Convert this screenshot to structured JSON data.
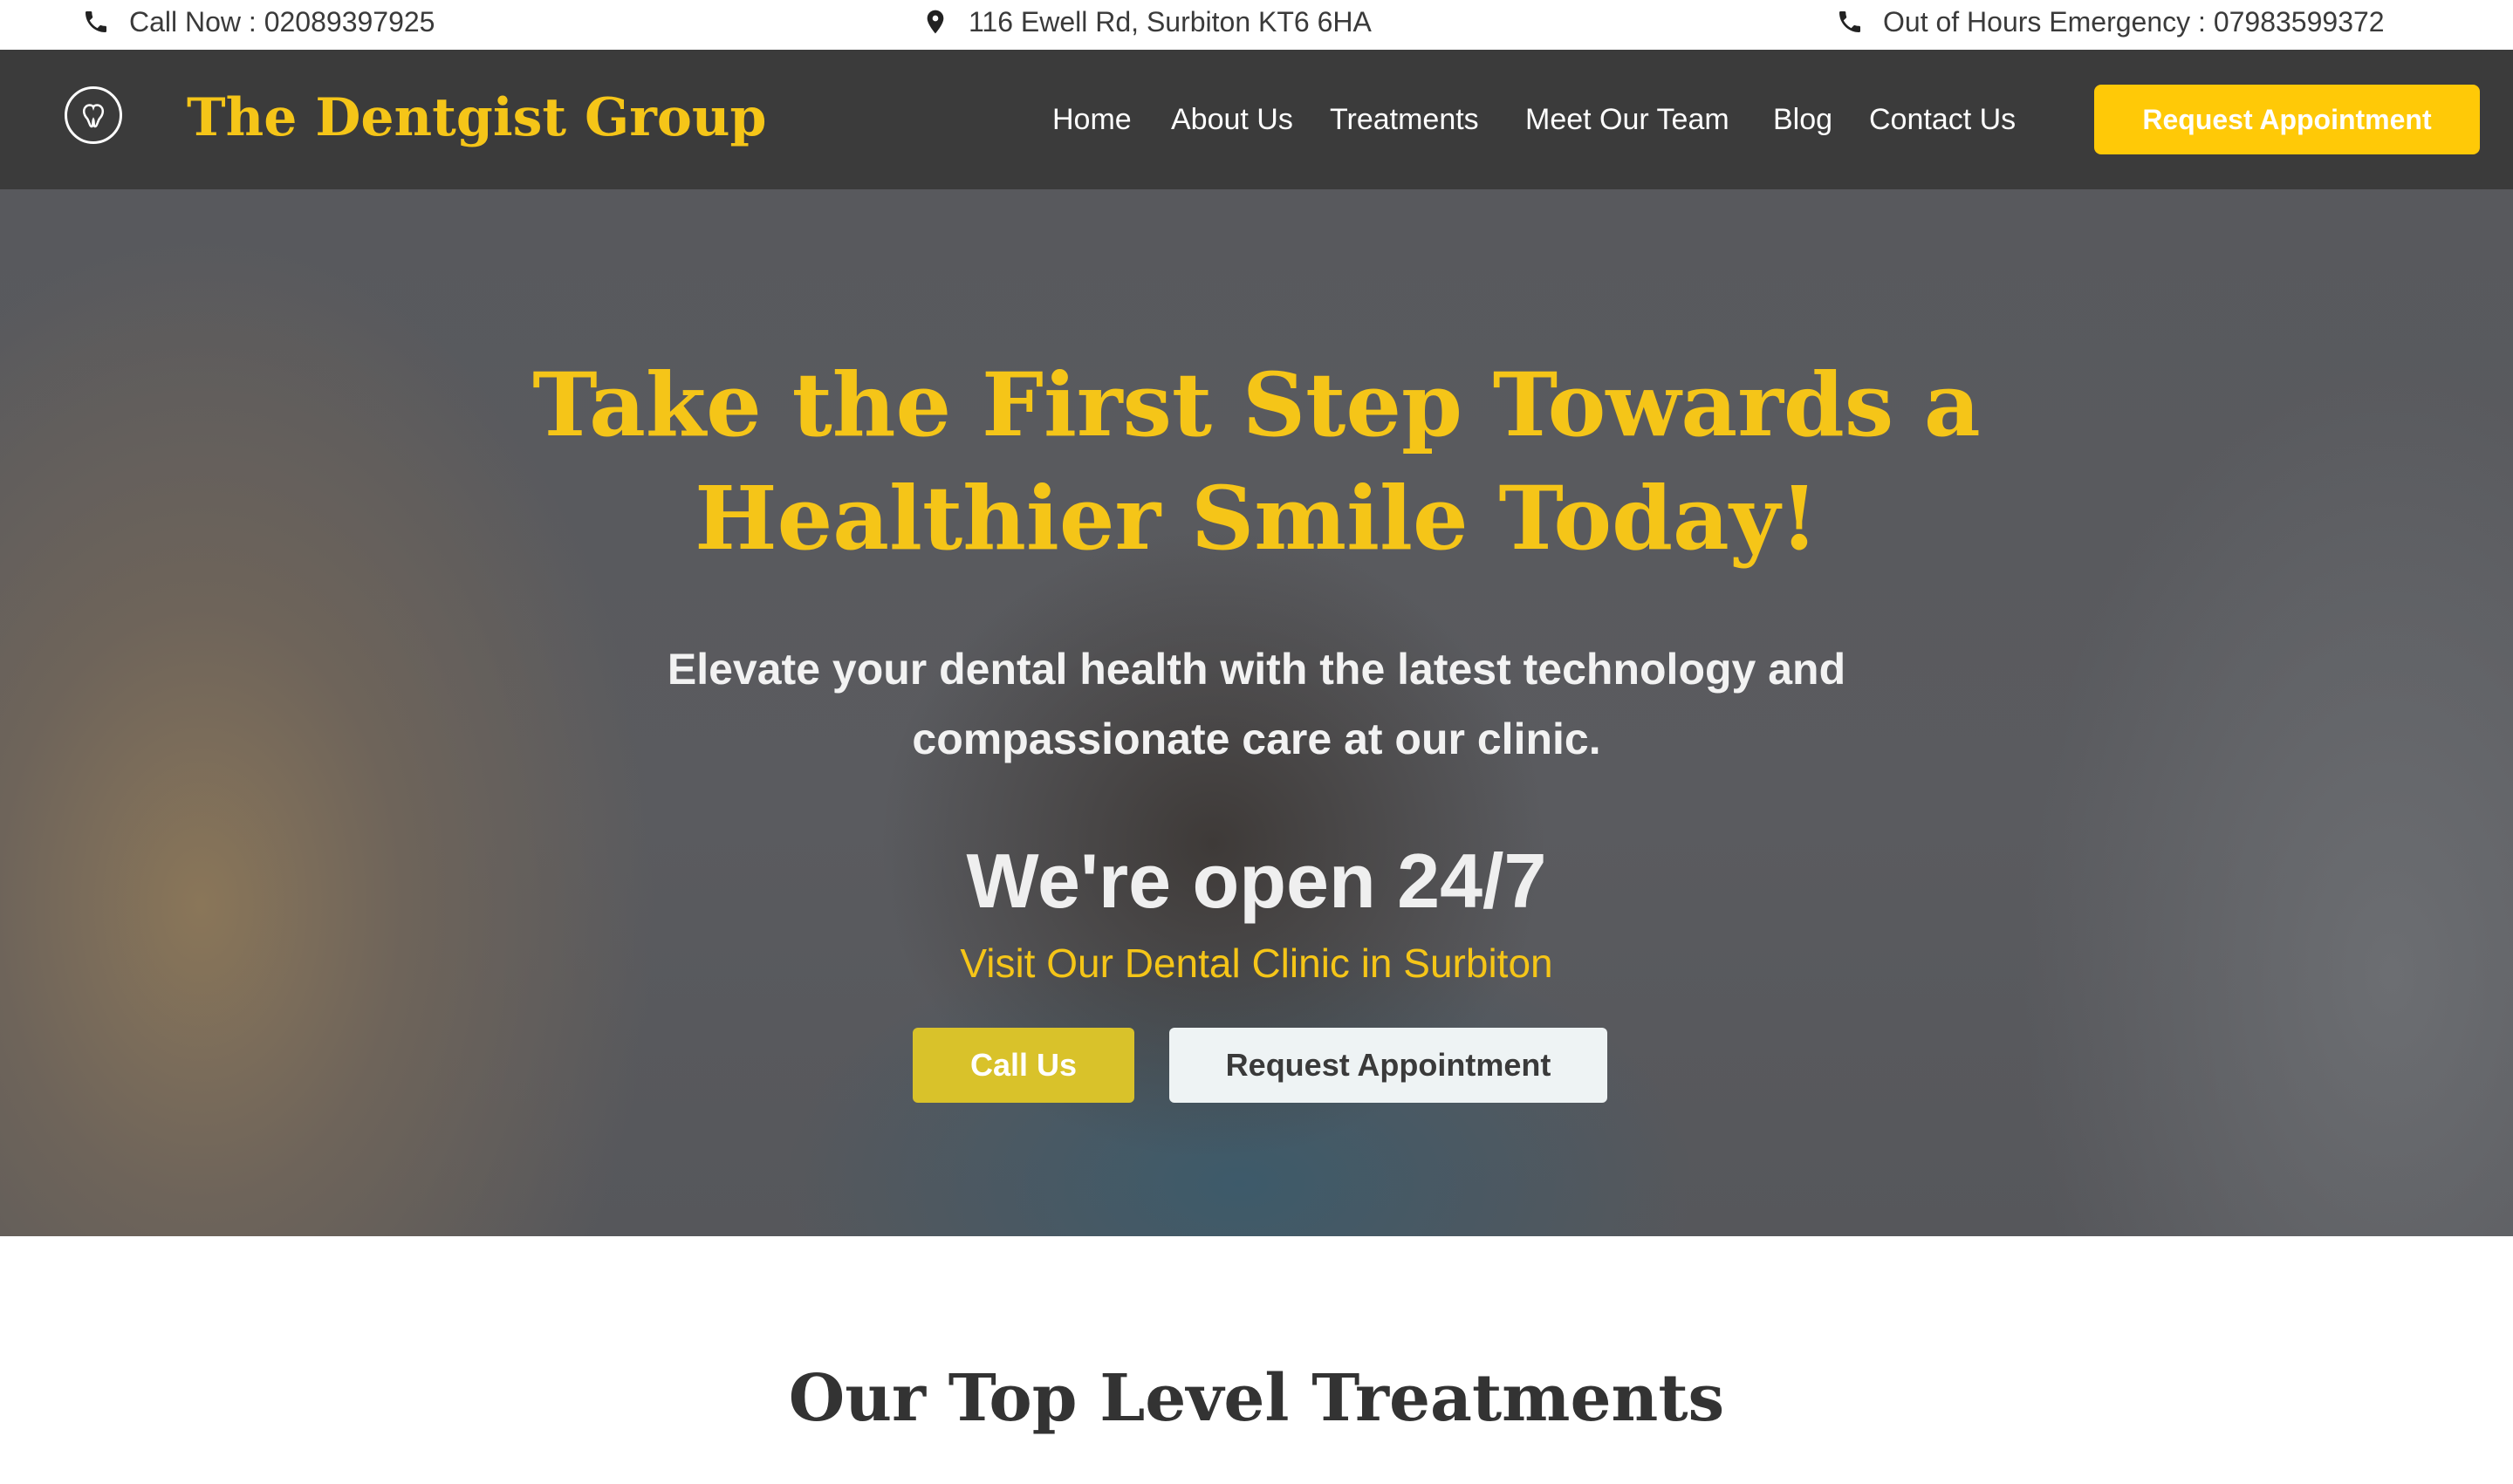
{
  "topbar": {
    "call": "Call Now : 02089397925",
    "address": "116 Ewell Rd, Surbiton KT6 6HA",
    "emergency": "Out of Hours Emergency : 07983599372"
  },
  "navbar": {
    "brand": "The Dentgist Group",
    "links": [
      "Home",
      "About Us",
      "Treatments",
      "Meet Our Team",
      "Blog",
      "Contact Us"
    ],
    "cta": "Request Appointment"
  },
  "hero": {
    "heading_line1": "Take the First Step Towards a",
    "heading_line2": "Healthier Smile Today!",
    "sub_line1": "Elevate your dental health with the latest technology and",
    "sub_line2": "compassionate care at our clinic.",
    "open": "We're open 24/7",
    "visit": "Visit Our Dental Clinic in Surbiton",
    "call_button": "Call Us",
    "request_button": "Request Appointment"
  },
  "treatments": {
    "title": "Our Top Level Treatments"
  },
  "colors": {
    "brand_yellow": "#f5c518",
    "cta_yellow": "#ffc907",
    "nav_bg": "#3b3b3b"
  }
}
